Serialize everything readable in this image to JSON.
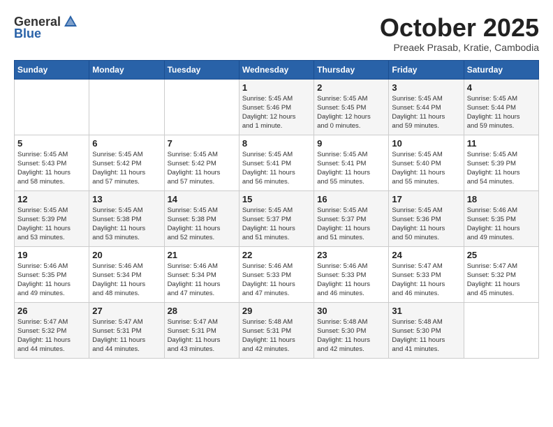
{
  "logo": {
    "general": "General",
    "blue": "Blue"
  },
  "title": {
    "month": "October 2025",
    "location": "Preaek Prasab, Kratie, Cambodia"
  },
  "headers": [
    "Sunday",
    "Monday",
    "Tuesday",
    "Wednesday",
    "Thursday",
    "Friday",
    "Saturday"
  ],
  "weeks": [
    [
      {
        "day": "",
        "info": ""
      },
      {
        "day": "",
        "info": ""
      },
      {
        "day": "",
        "info": ""
      },
      {
        "day": "1",
        "info": "Sunrise: 5:45 AM\nSunset: 5:46 PM\nDaylight: 12 hours\nand 1 minute."
      },
      {
        "day": "2",
        "info": "Sunrise: 5:45 AM\nSunset: 5:45 PM\nDaylight: 12 hours\nand 0 minutes."
      },
      {
        "day": "3",
        "info": "Sunrise: 5:45 AM\nSunset: 5:44 PM\nDaylight: 11 hours\nand 59 minutes."
      },
      {
        "day": "4",
        "info": "Sunrise: 5:45 AM\nSunset: 5:44 PM\nDaylight: 11 hours\nand 59 minutes."
      }
    ],
    [
      {
        "day": "5",
        "info": "Sunrise: 5:45 AM\nSunset: 5:43 PM\nDaylight: 11 hours\nand 58 minutes."
      },
      {
        "day": "6",
        "info": "Sunrise: 5:45 AM\nSunset: 5:42 PM\nDaylight: 11 hours\nand 57 minutes."
      },
      {
        "day": "7",
        "info": "Sunrise: 5:45 AM\nSunset: 5:42 PM\nDaylight: 11 hours\nand 57 minutes."
      },
      {
        "day": "8",
        "info": "Sunrise: 5:45 AM\nSunset: 5:41 PM\nDaylight: 11 hours\nand 56 minutes."
      },
      {
        "day": "9",
        "info": "Sunrise: 5:45 AM\nSunset: 5:41 PM\nDaylight: 11 hours\nand 55 minutes."
      },
      {
        "day": "10",
        "info": "Sunrise: 5:45 AM\nSunset: 5:40 PM\nDaylight: 11 hours\nand 55 minutes."
      },
      {
        "day": "11",
        "info": "Sunrise: 5:45 AM\nSunset: 5:39 PM\nDaylight: 11 hours\nand 54 minutes."
      }
    ],
    [
      {
        "day": "12",
        "info": "Sunrise: 5:45 AM\nSunset: 5:39 PM\nDaylight: 11 hours\nand 53 minutes."
      },
      {
        "day": "13",
        "info": "Sunrise: 5:45 AM\nSunset: 5:38 PM\nDaylight: 11 hours\nand 53 minutes."
      },
      {
        "day": "14",
        "info": "Sunrise: 5:45 AM\nSunset: 5:38 PM\nDaylight: 11 hours\nand 52 minutes."
      },
      {
        "day": "15",
        "info": "Sunrise: 5:45 AM\nSunset: 5:37 PM\nDaylight: 11 hours\nand 51 minutes."
      },
      {
        "day": "16",
        "info": "Sunrise: 5:45 AM\nSunset: 5:37 PM\nDaylight: 11 hours\nand 51 minutes."
      },
      {
        "day": "17",
        "info": "Sunrise: 5:45 AM\nSunset: 5:36 PM\nDaylight: 11 hours\nand 50 minutes."
      },
      {
        "day": "18",
        "info": "Sunrise: 5:46 AM\nSunset: 5:35 PM\nDaylight: 11 hours\nand 49 minutes."
      }
    ],
    [
      {
        "day": "19",
        "info": "Sunrise: 5:46 AM\nSunset: 5:35 PM\nDaylight: 11 hours\nand 49 minutes."
      },
      {
        "day": "20",
        "info": "Sunrise: 5:46 AM\nSunset: 5:34 PM\nDaylight: 11 hours\nand 48 minutes."
      },
      {
        "day": "21",
        "info": "Sunrise: 5:46 AM\nSunset: 5:34 PM\nDaylight: 11 hours\nand 47 minutes."
      },
      {
        "day": "22",
        "info": "Sunrise: 5:46 AM\nSunset: 5:33 PM\nDaylight: 11 hours\nand 47 minutes."
      },
      {
        "day": "23",
        "info": "Sunrise: 5:46 AM\nSunset: 5:33 PM\nDaylight: 11 hours\nand 46 minutes."
      },
      {
        "day": "24",
        "info": "Sunrise: 5:47 AM\nSunset: 5:33 PM\nDaylight: 11 hours\nand 46 minutes."
      },
      {
        "day": "25",
        "info": "Sunrise: 5:47 AM\nSunset: 5:32 PM\nDaylight: 11 hours\nand 45 minutes."
      }
    ],
    [
      {
        "day": "26",
        "info": "Sunrise: 5:47 AM\nSunset: 5:32 PM\nDaylight: 11 hours\nand 44 minutes."
      },
      {
        "day": "27",
        "info": "Sunrise: 5:47 AM\nSunset: 5:31 PM\nDaylight: 11 hours\nand 44 minutes."
      },
      {
        "day": "28",
        "info": "Sunrise: 5:47 AM\nSunset: 5:31 PM\nDaylight: 11 hours\nand 43 minutes."
      },
      {
        "day": "29",
        "info": "Sunrise: 5:48 AM\nSunset: 5:31 PM\nDaylight: 11 hours\nand 42 minutes."
      },
      {
        "day": "30",
        "info": "Sunrise: 5:48 AM\nSunset: 5:30 PM\nDaylight: 11 hours\nand 42 minutes."
      },
      {
        "day": "31",
        "info": "Sunrise: 5:48 AM\nSunset: 5:30 PM\nDaylight: 11 hours\nand 41 minutes."
      },
      {
        "day": "",
        "info": ""
      }
    ]
  ]
}
